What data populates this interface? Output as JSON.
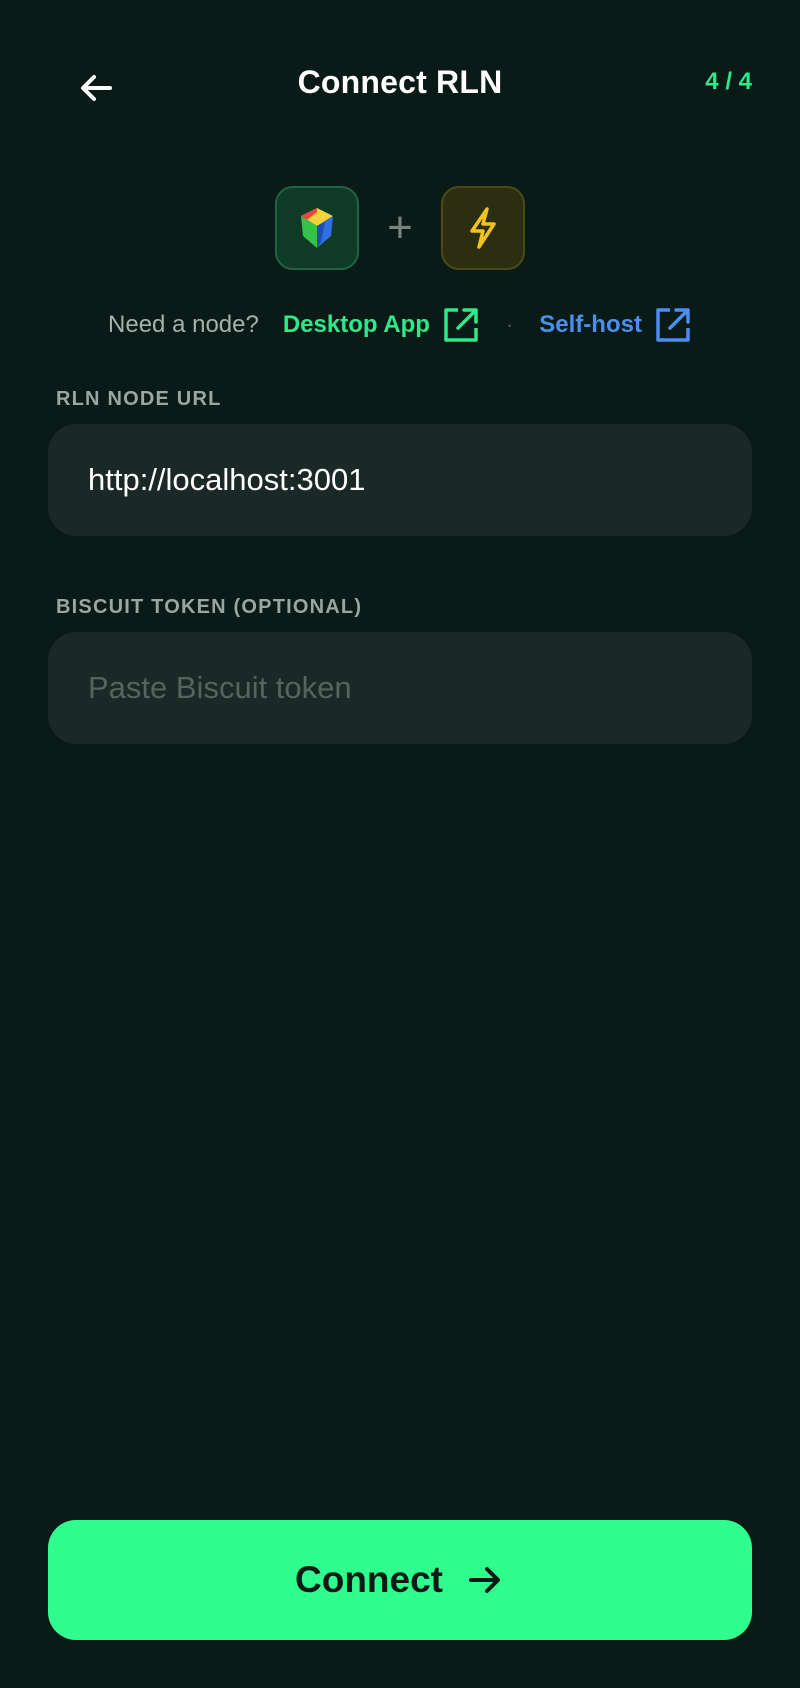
{
  "header": {
    "title": "Connect RLN",
    "step": "4 / 4"
  },
  "icons": {
    "back": "arrow-left-icon",
    "rgb_logo": "rgb-logo-icon",
    "plus": "plus-icon",
    "lightning": "lightning-icon",
    "external_link": "external-link-icon",
    "connect_arrow": "arrow-right-icon"
  },
  "logos": {
    "plus": "+"
  },
  "node_help": {
    "prompt": "Need a node?",
    "desktop_app": "Desktop App",
    "separator": "·",
    "self_host": "Self-host"
  },
  "fields": {
    "node_url": {
      "label": "RLN NODE URL",
      "value": "http://localhost:3001",
      "placeholder": ""
    },
    "biscuit_token": {
      "label": "BISCUIT TOKEN (OPTIONAL)",
      "value": "",
      "placeholder": "Paste Biscuit token"
    }
  },
  "connect_button": {
    "label": "Connect"
  },
  "colors": {
    "background": "#0a1a17",
    "accent_green": "#2ee88a",
    "button_green": "#2ffd8e",
    "link_blue": "#4a8ff0",
    "input_bg": "#1a2826",
    "lightning_yellow": "#f2c21f"
  }
}
